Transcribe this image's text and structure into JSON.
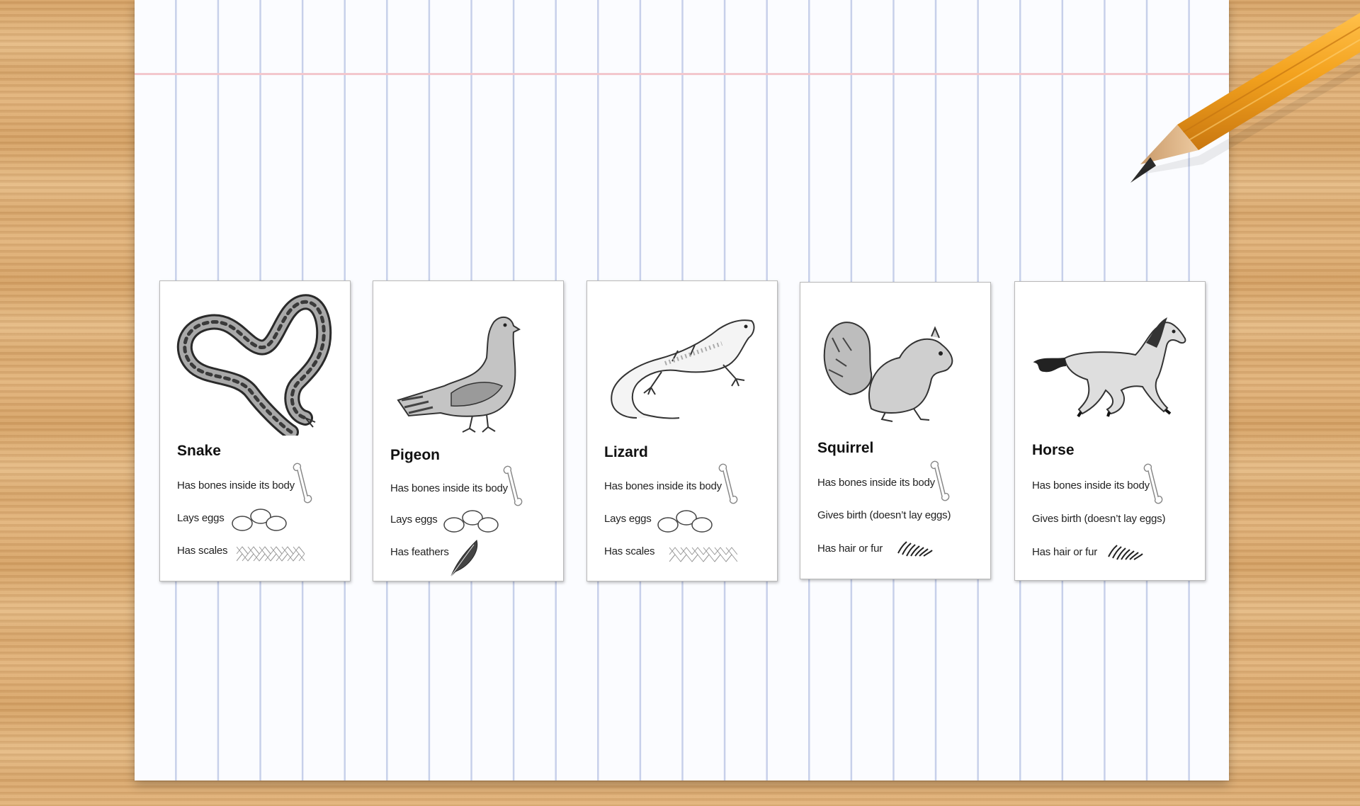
{
  "cards": [
    {
      "name": "Snake",
      "image_icon": "snake-drawing",
      "traits": [
        {
          "label": "Has bones inside its body",
          "icon": "bone-icon"
        },
        {
          "label": "Lays eggs",
          "icon": "eggs-icon"
        },
        {
          "label": "Has scales",
          "icon": "scales-icon"
        }
      ]
    },
    {
      "name": "Pigeon",
      "image_icon": "pigeon-drawing",
      "traits": [
        {
          "label": "Has bones inside its body",
          "icon": "bone-icon"
        },
        {
          "label": "Lays eggs",
          "icon": "eggs-icon"
        },
        {
          "label": "Has feathers",
          "icon": "feather-icon"
        }
      ]
    },
    {
      "name": "Lizard",
      "image_icon": "lizard-drawing",
      "traits": [
        {
          "label": "Has bones inside its body",
          "icon": "bone-icon"
        },
        {
          "label": "Lays eggs",
          "icon": "eggs-icon"
        },
        {
          "label": "Has scales",
          "icon": "scales-icon"
        }
      ]
    },
    {
      "name": "Squirrel",
      "image_icon": "squirrel-drawing",
      "traits": [
        {
          "label": "Has bones inside its body",
          "icon": "bone-icon"
        },
        {
          "label": "Gives birth (doesn’t lay eggs)",
          "icon": "none"
        },
        {
          "label": "Has hair or fur",
          "icon": "fur-icon"
        }
      ]
    },
    {
      "name": "Horse",
      "image_icon": "horse-drawing",
      "traits": [
        {
          "label": "Has bones inside its body",
          "icon": "bone-icon"
        },
        {
          "label": "Gives birth (doesn’t lay eggs)",
          "icon": "none"
        },
        {
          "label": "Has hair or fur",
          "icon": "fur-icon"
        }
      ]
    }
  ],
  "colors": {
    "paper": "#fbfcff",
    "paper_lines": "#c7d0ea",
    "margin_line": "#f3c7cd",
    "desk": "#dcae75",
    "pencil_body": "#f0a21f"
  }
}
